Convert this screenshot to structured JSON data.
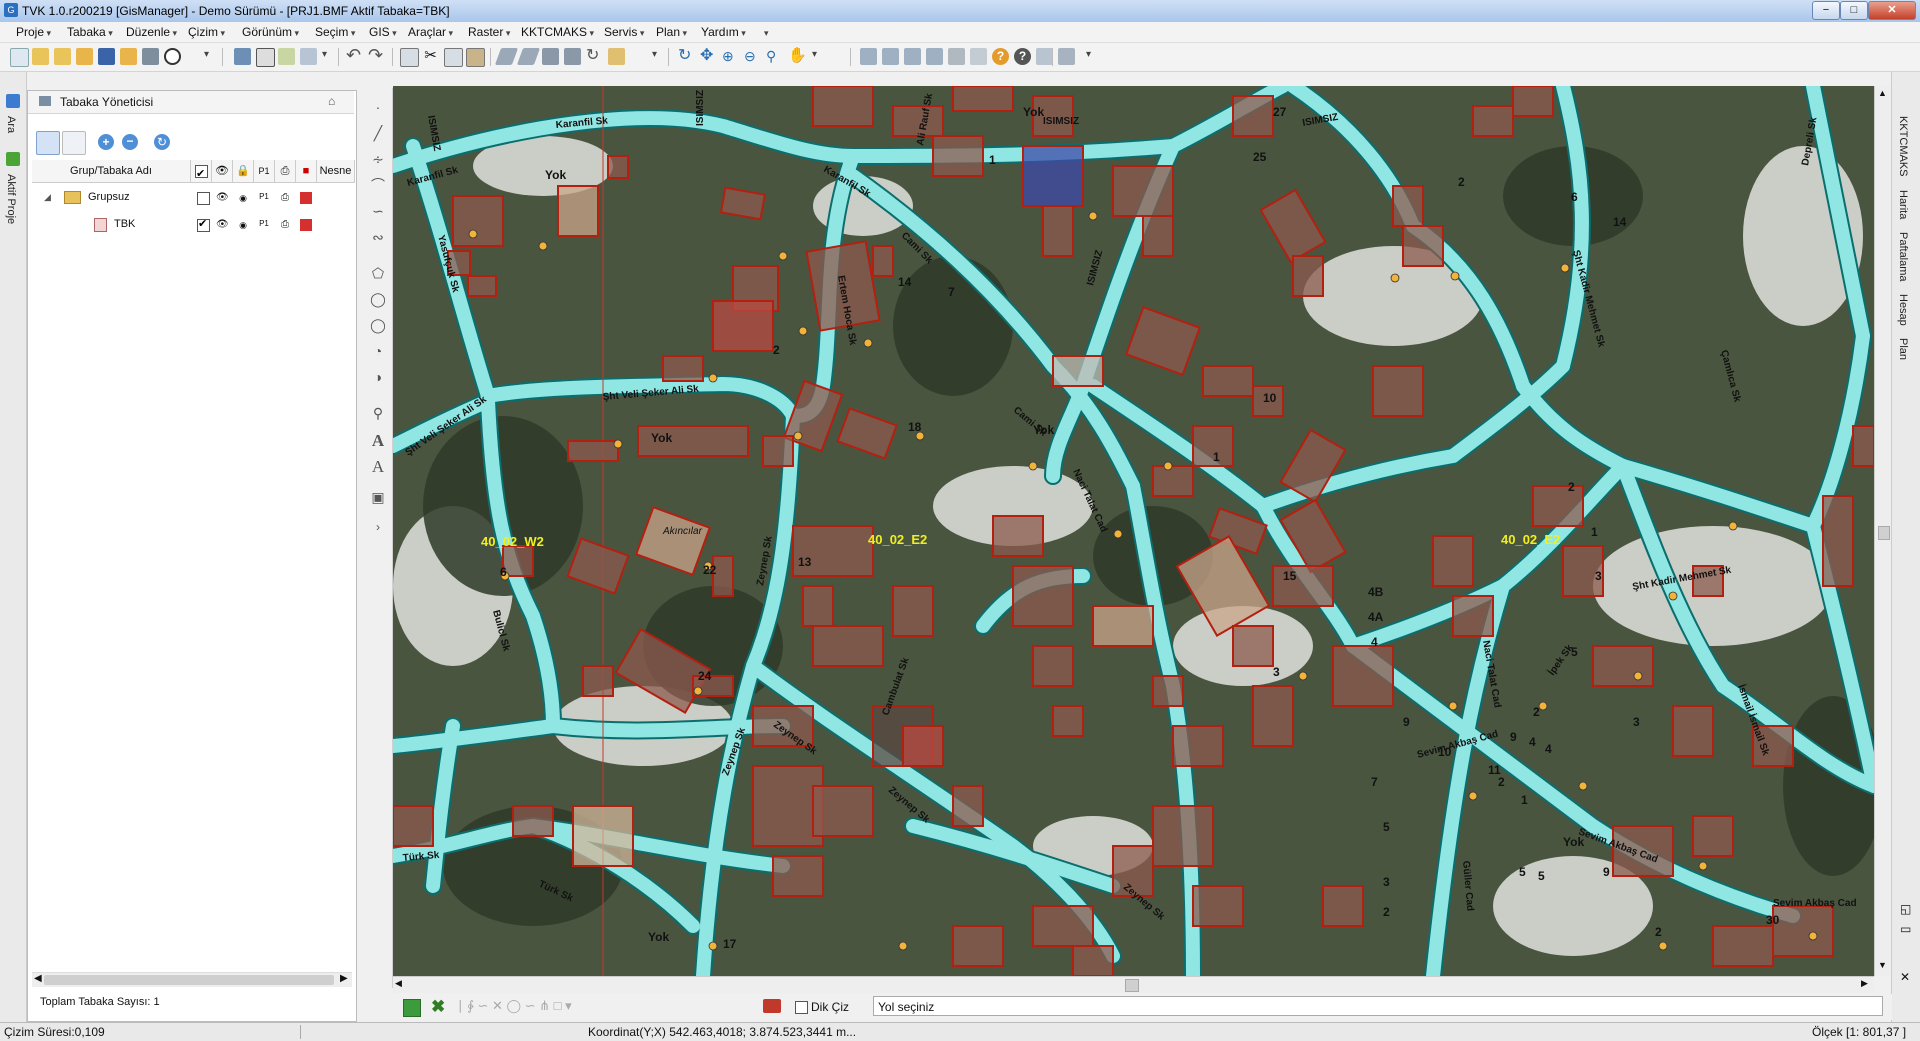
{
  "window": {
    "title": "TVK 1.0.r200219 [GisManager] - Demo Sürümü - [PRJ1.BMF  Aktif Tabaka=TBK]",
    "app_icon": "map-app-icon",
    "minimize": "−",
    "maximize": "□",
    "close": "✕"
  },
  "menu": {
    "items": [
      "Proje",
      "Tabaka",
      "Düzenle",
      "Çizim",
      "Görünüm",
      "Seçim",
      "GIS",
      "Araçlar",
      "Raster",
      "KKTCMAKS",
      "Servis",
      "Plan",
      "Yardım"
    ]
  },
  "left_strip": {
    "tabs": [
      "Ara",
      "Aktif Proje"
    ]
  },
  "layer_panel": {
    "title": "Tabaka Yöneticisi",
    "pin": "⌂",
    "columns": {
      "name": "Grup/Tabaka Adı",
      "object": "Nesne"
    },
    "tree": [
      {
        "label": "Grupsuz",
        "level": 0,
        "expanded": true,
        "checked": false
      },
      {
        "label": "TBK",
        "level": 1,
        "checked": true
      }
    ],
    "footer": "Toplam Tabaka Sayısı: 1"
  },
  "map": {
    "sheets": [
      "40_02_W2",
      "40_02_E2",
      "40_02_E2"
    ],
    "streets": [
      "Karanfil Sk",
      "Karanfil Sk",
      "Karanfil Sk",
      "Ali Rauf Sk",
      "ISIMSIZ",
      "ISIMSIZ",
      "ISIMSIZ",
      "ISIMSIZ",
      "ISIMSIZ",
      "Cami Sk",
      "Cami Sk",
      "Ertem Hoca Sk",
      "Yasufçuk Sk",
      "Şht Veli Şeker Ali Sk",
      "Şht Veli Şeker Ali Sk",
      "Naci Talat Cad",
      "Naci Talat Cad",
      "Şht Kadir Mehmet Sk",
      "Şht Kadir Mehmet Sk",
      "Depreli Sk",
      "Çamlıca Sk",
      "Bulicl Sk",
      "Zeynep Sk",
      "Zeynep Sk",
      "Zeynep Sk",
      "Zeynep Sk",
      "Cambulat Sk",
      "İpek Sk",
      "İsmail İsmail Sk",
      "Sevim Akbaş Cad",
      "Sevim Akbaş Cad",
      "Sevim Akbaş Cad",
      "Güller Cad",
      "Türk Sk",
      "Türk Sk",
      "Zeynep Sk",
      "Akıncılar"
    ],
    "labels": [
      "Yok",
      "Yok",
      "Yok",
      "Yok",
      "Yok",
      "Yok",
      "27",
      "25",
      "2",
      "6",
      "14",
      "14",
      "7",
      "2",
      "10",
      "18",
      "1",
      "2",
      "1",
      "3",
      "15",
      "4B",
      "4A",
      "4",
      "3",
      "5",
      "5",
      "3",
      "9",
      "10",
      "11",
      "9",
      "4",
      "2",
      "1",
      "7",
      "5",
      "3",
      "2",
      "5",
      "9",
      "30",
      "2",
      "22",
      "24",
      "6",
      "13",
      "17",
      "1",
      "4",
      "2"
    ]
  },
  "command_bar": {
    "ortho": "Dik Çiz",
    "prompt": "Yol seçiniz"
  },
  "status": {
    "draw_time": "Çizim Süresi:0,109",
    "coordinate": "Koordinat(Y;X)  542.463,4018; 3.874.523,3441 m...",
    "scale": "Ölçek [1: 801,37 ]"
  },
  "right_strip": {
    "tabs": [
      "KKTCMAKS",
      "Harita",
      "Paftalama",
      "Hesap",
      "Plan"
    ]
  }
}
